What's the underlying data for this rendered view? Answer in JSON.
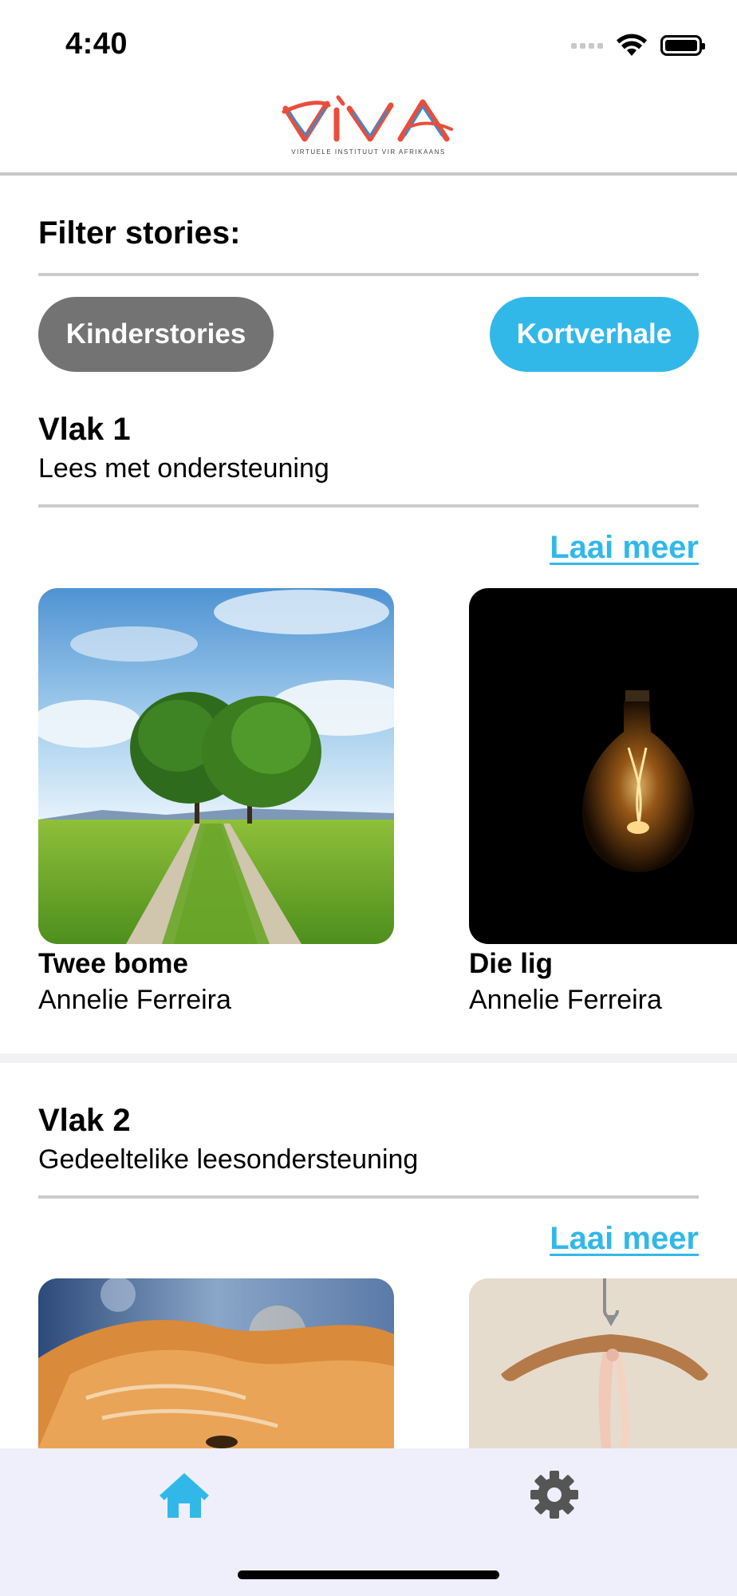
{
  "status_bar": {
    "time": "4:40"
  },
  "header": {
    "logo_text": "VIVA",
    "logo_tagline": "VIRTUELE INSTITUUT VIR AFRIKAANS"
  },
  "filter": {
    "title": "Filter stories:",
    "options": [
      {
        "label": "Kinderstories",
        "selected": false,
        "color": "#737373"
      },
      {
        "label": "Kortverhale",
        "selected": true,
        "color": "#32b8e8"
      }
    ]
  },
  "levels": [
    {
      "title": "Vlak 1",
      "subtitle": "Lees met ondersteuning",
      "load_more": "Laai meer",
      "stories": [
        {
          "title": "Twee bome",
          "author": "Annelie Ferreira",
          "image": "two-trees-road"
        },
        {
          "title": "Die lig",
          "author": "Annelie Ferreira",
          "image": "light-bulb"
        }
      ]
    },
    {
      "title": "Vlak 2",
      "subtitle": "Gedeeltelike leesondersteuning",
      "load_more": "Laai meer",
      "stories": [
        {
          "image": "orange-cat"
        },
        {
          "image": "wooden-hanger"
        }
      ]
    }
  ],
  "tab_bar": {
    "tabs": [
      {
        "icon": "home-icon",
        "active": true,
        "color": "#32b8e8"
      },
      {
        "icon": "gear-icon",
        "active": false,
        "color": "#555555"
      }
    ]
  },
  "colors": {
    "accent": "#32b8e8",
    "pill_grey": "#737373",
    "tabbar_bg": "#efeffb"
  }
}
